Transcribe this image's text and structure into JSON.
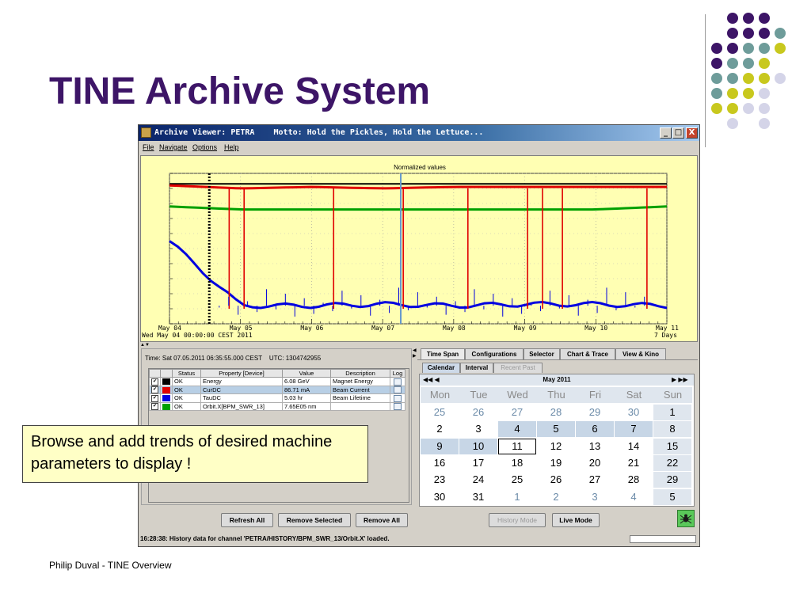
{
  "slide": {
    "title": "TINE Archive System",
    "footer": "Philip Duval - TINE Overview",
    "callout": "Browse and add trends of desired machine parameters to display !",
    "colors": {
      "title": "#3d1567",
      "dot_purple": "#3d1567",
      "dot_teal": "#6e9c9a",
      "dot_yellow": "#c8c81e",
      "dot_lavender": "#d4d4e8"
    }
  },
  "window": {
    "title": "Archive Viewer: PETRA    Motto: Hold the Pickles, Hold the Lettuce...",
    "controls": {
      "minimize": "_",
      "maximize": "□",
      "close": "X"
    },
    "menu": [
      "File",
      "Navigate",
      "Options",
      "Help"
    ]
  },
  "plot": {
    "title": "Normalized values",
    "x_ticks": [
      "May 04",
      "May 05",
      "May 06",
      "May 07",
      "May 08",
      "May 09",
      "May 10",
      "May 11"
    ],
    "x_start": "Wed May 04 00:00:00 CEST 2011",
    "x_span": "7 Days",
    "split_arrows": "▲▼"
  },
  "chart_data": {
    "type": "line",
    "title": "Normalized values",
    "x": [
      "May 04",
      "May 05",
      "May 06",
      "May 07",
      "May 08",
      "May 09",
      "May 10",
      "May 11"
    ],
    "series": [
      {
        "name": "Energy",
        "color": "#000000",
        "values": [
          0.93,
          0.93,
          0.93,
          0.93,
          0.93,
          0.93,
          0.93,
          0.93
        ]
      },
      {
        "name": "CurDC",
        "color": "#e00000",
        "values": [
          0.92,
          0.9,
          0.91,
          0.9,
          0.91,
          0.91,
          0.91,
          0.91
        ]
      },
      {
        "name": "TauDC",
        "color": "#0000e0",
        "values": [
          0.55,
          0.12,
          0.12,
          0.13,
          0.12,
          0.13,
          0.13,
          0.12
        ]
      },
      {
        "name": "Orbit.X[BPM_SWR_13]",
        "color": "#00a000",
        "values": [
          0.78,
          0.76,
          0.76,
          0.76,
          0.76,
          0.76,
          0.76,
          0.78
        ]
      }
    ],
    "xlabel": "",
    "ylabel": "",
    "ylim": [
      0,
      1
    ]
  },
  "properties": {
    "time_line": "Time: Sat 07.05.2011 06:35:55.000 CEST    UTC: 1304742955",
    "headers": [
      "",
      "",
      "Status",
      "Property [Device]",
      "Value",
      "Description",
      "Log"
    ],
    "rows": [
      {
        "checked": "✔",
        "color": "#000000",
        "status": "OK",
        "property": "Energy",
        "value": "6.08 GeV",
        "description": "Magnet Energy"
      },
      {
        "checked": "✔",
        "color": "#e00000",
        "status": "OK",
        "property": "CurDC",
        "value": "86.71 mA",
        "description": "Beam Current"
      },
      {
        "checked": "✔",
        "color": "#0000e0",
        "status": "OK",
        "property": "TauDC",
        "value": "5.03 hr",
        "description": "Beam Lifetime"
      },
      {
        "checked": "✔",
        "color": "#00a000",
        "status": "OK",
        "property": "Orbit.X[BPM_SWR_13]",
        "value": "7.65E05 nm",
        "description": ""
      }
    ],
    "refresh_all": "Refresh All",
    "remove_selected": "Remove Selected",
    "remove_all": "Remove All"
  },
  "right": {
    "tabs": [
      "Time Span",
      "Configurations",
      "Selector",
      "Chart & Trace",
      "View & Kino"
    ],
    "subtabs": [
      "Calendar",
      "Interval",
      "Recent Past"
    ],
    "month": "May 2011",
    "nav_left": "◀◀  ◀",
    "nav_right": "▶  ▶▶",
    "weekdays": [
      "Mon",
      "Tue",
      "Wed",
      "Thu",
      "Fri",
      "Sat",
      "Sun"
    ],
    "weeks": [
      [
        "25",
        "26",
        "27",
        "28",
        "29",
        "30",
        "1"
      ],
      [
        "2",
        "3",
        "4",
        "5",
        "6",
        "7",
        "8"
      ],
      [
        "9",
        "10",
        "11",
        "12",
        "13",
        "14",
        "15"
      ],
      [
        "16",
        "17",
        "18",
        "19",
        "20",
        "21",
        "22"
      ],
      [
        "23",
        "24",
        "25",
        "26",
        "27",
        "28",
        "29"
      ],
      [
        "30",
        "31",
        "1",
        "2",
        "3",
        "4",
        "5"
      ]
    ],
    "history_mode": "History Mode",
    "live_mode": "Live Mode"
  },
  "status": {
    "text": "16:28:38: History data for channel 'PETRA/HISTORY/BPM_SWR_13/Orbit.X' loaded."
  }
}
